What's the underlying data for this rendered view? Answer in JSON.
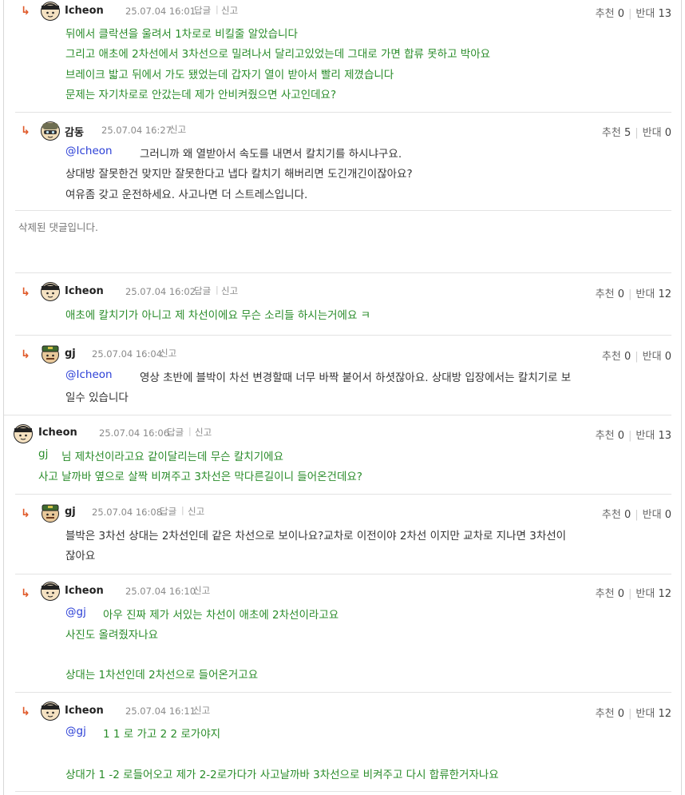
{
  "ui": {
    "recommend_label": "추천",
    "oppose_label": "반대",
    "reply_label": "답글",
    "report_label": "신고"
  },
  "comments": [
    {
      "author": "Icheon",
      "date": "25.07.04 16:01",
      "recommend": "0",
      "oppose": "13",
      "lines": [
        "뒤에서 클락션을 울려서 1차로로 비킬줄 알았습니다",
        "그리고 애초에 2차선에서 3차선으로 밀려나서 달리고있었는데 그대로 가면 합류 못하고 박아요",
        "브레이크 밟고 뒤에서 가도 됐었는데 갑자기 열이 받아서 빨리 제꼈습니다",
        "문제는 자기차로로 안갔는데 제가 안비켜줬으면 사고인데요?"
      ]
    },
    {
      "author": "감동",
      "date": "25.07.04 16:27",
      "recommend": "5",
      "oppose": "0",
      "mention": "@Icheon",
      "lines": [
        "그러니까 왜 열받아서 속도를 내면서 칼치기를 하시냐구요.",
        "상대방 잘못한건 맞지만 잘못한다고 냅다 칼치기 해버리면 도긴개긴이잖아요?",
        "여유좀 갖고 운전하세요. 사고나면 더 스트레스입니다."
      ]
    },
    {
      "deleted_text": "삭제된 댓글입니다."
    },
    {
      "author": "Icheon",
      "date": "25.07.04 16:02",
      "recommend": "0",
      "oppose": "12",
      "lines": [
        "애초에 칼치기가 아니고 제 차선이에요 무슨 소리들 하시는거에요 ㅋ"
      ]
    },
    {
      "author": "gj",
      "date": "25.07.04 16:04",
      "recommend": "0",
      "oppose": "0",
      "mention": "@Icheon",
      "lines": [
        "영상 초반에 블박이 차선 변경할때 너무 바짝 붙어서 하셧잖아요. 상대방 입장에서는 칼치기로 보",
        "일수 있습니다"
      ]
    },
    {
      "author": "Icheon",
      "date": "25.07.04 16:06",
      "recommend": "0",
      "oppose": "13",
      "mention": "gj",
      "lines": [
        "님 제차선이라고요 같이달리는데 무슨 칼치기에요",
        "사고 날까바 옆으로 살짝 비껴주고 3차선은 막다른길이니 들어온건데요?"
      ]
    },
    {
      "author": "gj",
      "date": "25.07.04 16:08",
      "recommend": "0",
      "oppose": "0",
      "lines": [
        "블박은 3차선 상대는 2차선인데 같은 차선으로 보이나요?교차로 이전이야 2차선 이지만 교차로 지나면 3차선이",
        "잖아요"
      ]
    },
    {
      "author": "Icheon",
      "date": "25.07.04 16:10",
      "recommend": "0",
      "oppose": "12",
      "mention": "@gj",
      "lines": [
        "아우 진짜 제가 서있는 차선이 애초에 2차선이라고요",
        "사진도 올려줬자나요",
        "상대는 1차선인데 2차선으로 들어온거고요"
      ]
    },
    {
      "author": "Icheon",
      "date": "25.07.04 16:11",
      "recommend": "0",
      "oppose": "12",
      "mention": "@gj",
      "lines": [
        "1 1 로 가고 2 2 로가야지",
        "상대가 1 -2 로들어오고 제가 2-2로가다가 사고날까바 3차선으로 비켜주고 다시 합류한거자나요"
      ]
    }
  ]
}
